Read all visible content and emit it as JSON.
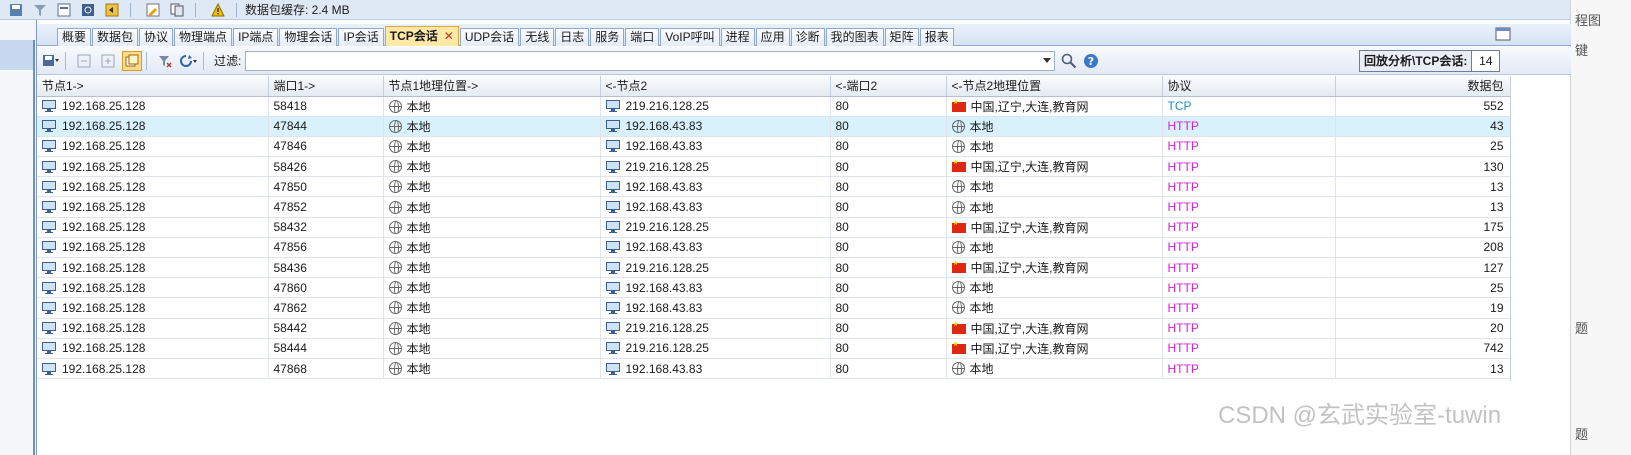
{
  "top_toolbar": {
    "cache_label": "数据包缓存: 2.4 MB"
  },
  "tabs": [
    {
      "label": "概要"
    },
    {
      "label": "数据包"
    },
    {
      "label": "协议"
    },
    {
      "label": "物理端点"
    },
    {
      "label": "IP端点"
    },
    {
      "label": "物理会话"
    },
    {
      "label": "IP会话"
    },
    {
      "label": "TCP会话",
      "active": true,
      "close": "✕"
    },
    {
      "label": "UDP会话"
    },
    {
      "label": "无线"
    },
    {
      "label": "日志"
    },
    {
      "label": "服务"
    },
    {
      "label": "端口"
    },
    {
      "label": "VoIP呼叫"
    },
    {
      "label": "进程"
    },
    {
      "label": "应用"
    },
    {
      "label": "诊断"
    },
    {
      "label": "我的图表"
    },
    {
      "label": "矩阵"
    },
    {
      "label": "报表"
    }
  ],
  "toolbar": {
    "filter_label": "过滤:",
    "filter_value": "",
    "replay_label": "回放分析\\TCP会话:",
    "replay_count": "14"
  },
  "table": {
    "columns": [
      "节点1->",
      "端口1->",
      "节点1地理位置->",
      "<-节点2",
      "<-端口2",
      "<-节点2地理位置",
      "协议",
      "数据包"
    ],
    "rows": [
      {
        "node1": "192.168.25.128",
        "port1": "58418",
        "geo1": "本地",
        "node2": "219.216.128.25",
        "port2": "80",
        "geo2": "中国,辽宁,大连,教育网",
        "geo2_flag": "cn",
        "proto": "TCP",
        "packets": "552"
      },
      {
        "node1": "192.168.25.128",
        "port1": "47844",
        "geo1": "本地",
        "node2": "192.168.43.83",
        "port2": "80",
        "geo2": "本地",
        "geo2_flag": "local",
        "proto": "HTTP",
        "packets": "43",
        "selected": true
      },
      {
        "node1": "192.168.25.128",
        "port1": "47846",
        "geo1": "本地",
        "node2": "192.168.43.83",
        "port2": "80",
        "geo2": "本地",
        "geo2_flag": "local",
        "proto": "HTTP",
        "packets": "25"
      },
      {
        "node1": "192.168.25.128",
        "port1": "58426",
        "geo1": "本地",
        "node2": "219.216.128.25",
        "port2": "80",
        "geo2": "中国,辽宁,大连,教育网",
        "geo2_flag": "cn",
        "proto": "HTTP",
        "packets": "130"
      },
      {
        "node1": "192.168.25.128",
        "port1": "47850",
        "geo1": "本地",
        "node2": "192.168.43.83",
        "port2": "80",
        "geo2": "本地",
        "geo2_flag": "local",
        "proto": "HTTP",
        "packets": "13"
      },
      {
        "node1": "192.168.25.128",
        "port1": "47852",
        "geo1": "本地",
        "node2": "192.168.43.83",
        "port2": "80",
        "geo2": "本地",
        "geo2_flag": "local",
        "proto": "HTTP",
        "packets": "13"
      },
      {
        "node1": "192.168.25.128",
        "port1": "58432",
        "geo1": "本地",
        "node2": "219.216.128.25",
        "port2": "80",
        "geo2": "中国,辽宁,大连,教育网",
        "geo2_flag": "cn",
        "proto": "HTTP",
        "packets": "175"
      },
      {
        "node1": "192.168.25.128",
        "port1": "47856",
        "geo1": "本地",
        "node2": "192.168.43.83",
        "port2": "80",
        "geo2": "本地",
        "geo2_flag": "local",
        "proto": "HTTP",
        "packets": "208"
      },
      {
        "node1": "192.168.25.128",
        "port1": "58436",
        "geo1": "本地",
        "node2": "219.216.128.25",
        "port2": "80",
        "geo2": "中国,辽宁,大连,教育网",
        "geo2_flag": "cn",
        "proto": "HTTP",
        "packets": "127"
      },
      {
        "node1": "192.168.25.128",
        "port1": "47860",
        "geo1": "本地",
        "node2": "192.168.43.83",
        "port2": "80",
        "geo2": "本地",
        "geo2_flag": "local",
        "proto": "HTTP",
        "packets": "25"
      },
      {
        "node1": "192.168.25.128",
        "port1": "47862",
        "geo1": "本地",
        "node2": "192.168.43.83",
        "port2": "80",
        "geo2": "本地",
        "geo2_flag": "local",
        "proto": "HTTP",
        "packets": "19"
      },
      {
        "node1": "192.168.25.128",
        "port1": "58442",
        "geo1": "本地",
        "node2": "219.216.128.25",
        "port2": "80",
        "geo2": "中国,辽宁,大连,教育网",
        "geo2_flag": "cn",
        "proto": "HTTP",
        "packets": "20"
      },
      {
        "node1": "192.168.25.128",
        "port1": "58444",
        "geo1": "本地",
        "node2": "219.216.128.25",
        "port2": "80",
        "geo2": "中国,辽宁,大连,教育网",
        "geo2_flag": "cn",
        "proto": "HTTP",
        "packets": "742"
      },
      {
        "node1": "192.168.25.128",
        "port1": "47868",
        "geo1": "本地",
        "node2": "192.168.43.83",
        "port2": "80",
        "geo2": "本地",
        "geo2_flag": "local",
        "proto": "HTTP",
        "packets": "13"
      }
    ]
  },
  "right_panel": [
    "程图",
    "键",
    "题",
    "题"
  ],
  "watermark": "CSDN @玄武实验室-tuwin",
  "colors": {
    "tcp": "#1f8fc7",
    "http": "#d61fd6",
    "active_tab": "#ffe9a6",
    "selected_row": "#d8f1fb"
  }
}
